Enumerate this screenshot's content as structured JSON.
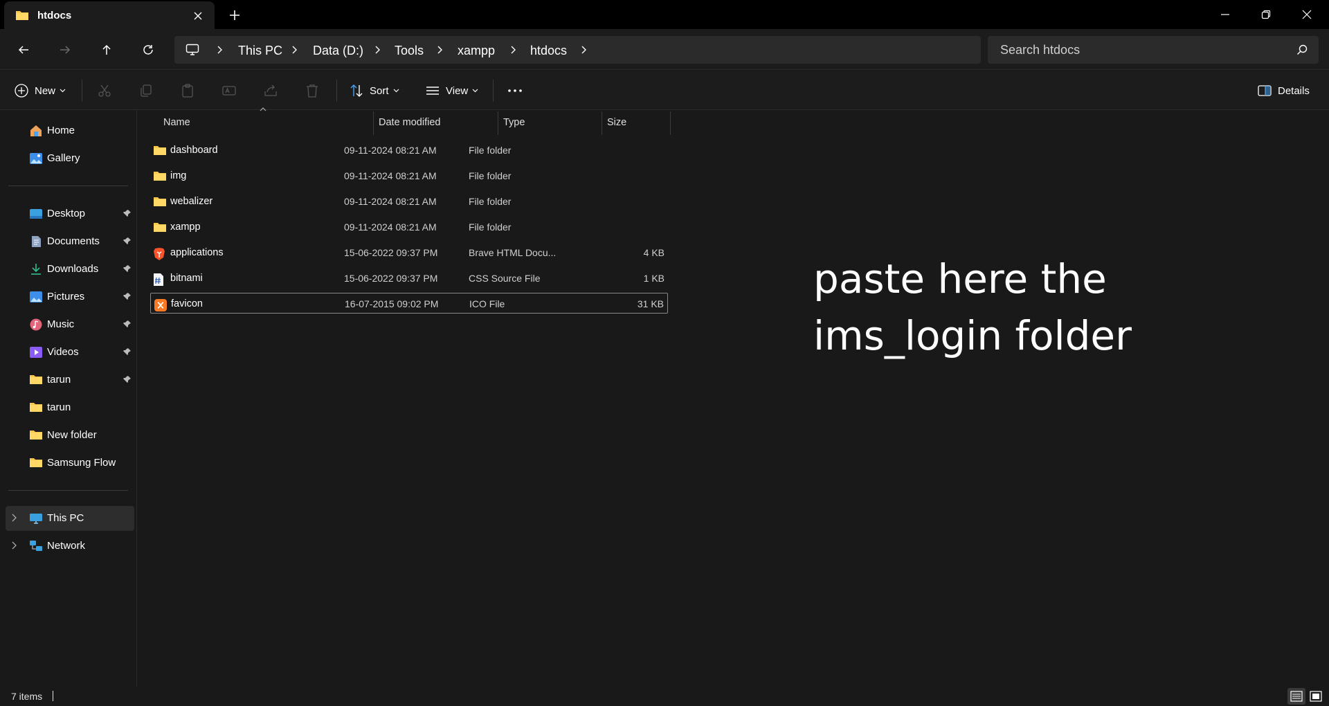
{
  "tab": {
    "title": "htdocs"
  },
  "address": {
    "crumbs": [
      "This PC",
      "Data (D:)",
      "Tools",
      "xampp",
      "htdocs"
    ]
  },
  "search": {
    "placeholder": "Search htdocs"
  },
  "commands": {
    "new_label": "New",
    "sort_label": "Sort",
    "view_label": "View",
    "details_label": "Details"
  },
  "sidebar": {
    "items": [
      {
        "label": "Home",
        "icon": "home-icon"
      },
      {
        "label": "Gallery",
        "icon": "gallery-icon"
      },
      {
        "label": "Desktop",
        "icon": "desktop-icon",
        "pinned": true
      },
      {
        "label": "Documents",
        "icon": "documents-icon",
        "pinned": true
      },
      {
        "label": "Downloads",
        "icon": "downloads-icon",
        "pinned": true
      },
      {
        "label": "Pictures",
        "icon": "pictures-icon",
        "pinned": true
      },
      {
        "label": "Music",
        "icon": "music-icon",
        "pinned": true
      },
      {
        "label": "Videos",
        "icon": "videos-icon",
        "pinned": true
      },
      {
        "label": "tarun",
        "icon": "folder-icon",
        "pinned": true
      },
      {
        "label": "tarun",
        "icon": "folder-icon"
      },
      {
        "label": "New folder",
        "icon": "folder-icon"
      },
      {
        "label": "Samsung Flow",
        "icon": "folder-icon"
      },
      {
        "label": "This PC",
        "icon": "pc-icon",
        "selected": true
      },
      {
        "label": "Network",
        "icon": "network-icon"
      }
    ]
  },
  "columns": {
    "name": "Name",
    "date": "Date modified",
    "type": "Type",
    "size": "Size"
  },
  "files": [
    {
      "name": "dashboard",
      "date": "09-11-2024 08:21 AM",
      "type": "File folder",
      "size": "",
      "icon": "folder-icon"
    },
    {
      "name": "img",
      "date": "09-11-2024 08:21 AM",
      "type": "File folder",
      "size": "",
      "icon": "folder-icon"
    },
    {
      "name": "webalizer",
      "date": "09-11-2024 08:21 AM",
      "type": "File folder",
      "size": "",
      "icon": "folder-icon"
    },
    {
      "name": "xampp",
      "date": "09-11-2024 08:21 AM",
      "type": "File folder",
      "size": "",
      "icon": "folder-icon"
    },
    {
      "name": "applications",
      "date": "15-06-2022 09:37 PM",
      "type": "Brave HTML Docu...",
      "size": "4 KB",
      "icon": "brave-icon"
    },
    {
      "name": "bitnami",
      "date": "15-06-2022 09:37 PM",
      "type": "CSS Source File",
      "size": "1 KB",
      "icon": "css-file-icon"
    },
    {
      "name": "favicon",
      "date": "16-07-2015 09:02 PM",
      "type": "ICO File",
      "size": "31 KB",
      "icon": "xampp-icon",
      "selected": true
    }
  ],
  "overlay": {
    "line1": "paste here the",
    "line2": "ims_login folder"
  },
  "status": {
    "item_count": "7 items"
  },
  "colors": {
    "background": "#191919",
    "titlebar": "#000000",
    "folder": "#f8c94a",
    "accent": "#4aa3f0"
  }
}
